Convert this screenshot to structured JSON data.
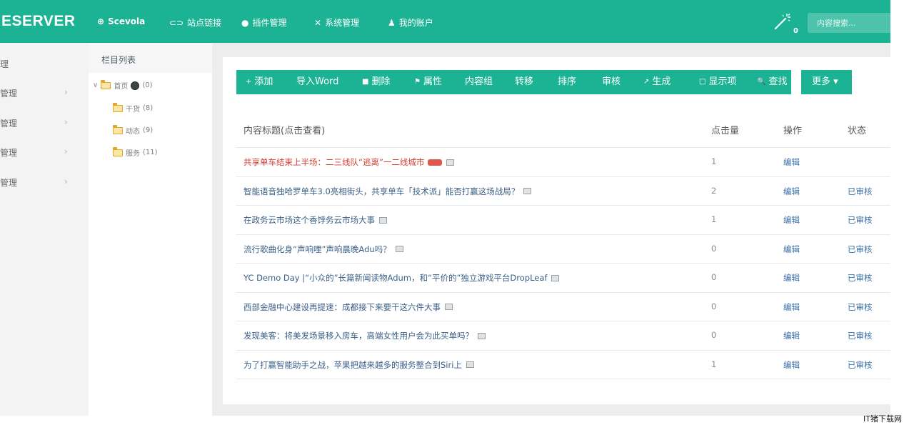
{
  "topbar": {
    "brand": "ESERVER",
    "nav": [
      {
        "label": "Scevola",
        "icon": "globe-icon",
        "glyph": "⊕"
      },
      {
        "label": "站点链接",
        "icon": "link-icon",
        "glyph": "⊂⊃"
      },
      {
        "label": "插件管理",
        "icon": "plugin-icon",
        "glyph": "●"
      },
      {
        "label": "系统管理",
        "icon": "tools-icon",
        "glyph": "✕"
      },
      {
        "label": "我的账户",
        "icon": "user-icon",
        "glyph": "♟"
      }
    ],
    "notification_count": "0",
    "search_placeholder": "内容搜索..."
  },
  "leftmenu": {
    "items": [
      {
        "label": "理",
        "chevron": ""
      },
      {
        "label": "管理",
        "chevron": "›"
      },
      {
        "label": "管理",
        "chevron": "›"
      },
      {
        "label": "管理",
        "chevron": "›"
      },
      {
        "label": "管理",
        "chevron": "›"
      }
    ]
  },
  "tree": {
    "title": "栏目列表",
    "root": {
      "toggle": "∨",
      "label": "首页",
      "count": "(0)"
    },
    "children": [
      {
        "label": "干货",
        "count": "(8)"
      },
      {
        "label": "动态",
        "count": "(9)"
      },
      {
        "label": "服务",
        "count": "(11)"
      }
    ]
  },
  "toolbar": {
    "buttons": [
      {
        "label": "添加",
        "glyph": "+"
      },
      {
        "label": "导入Word",
        "glyph": ""
      },
      {
        "label": "删除",
        "glyph": "■"
      },
      {
        "label": "属性",
        "glyph": "⚑"
      },
      {
        "label": "内容组",
        "glyph": ""
      },
      {
        "label": "转移",
        "glyph": ""
      },
      {
        "label": "排序",
        "glyph": ""
      },
      {
        "label": "审核",
        "glyph": ""
      },
      {
        "label": "生成",
        "glyph": "↗"
      },
      {
        "label": "显示项",
        "glyph": "□"
      },
      {
        "label": "查找",
        "glyph": "🔍"
      }
    ],
    "more_label": "更多 ▾"
  },
  "table": {
    "columns": [
      "内容标题(点击查看)",
      "点击量",
      "操作",
      "状态"
    ],
    "rows": [
      {
        "title": "共享单车结束上半场：二三线队“逃离”一二线城市",
        "hot": true,
        "clicks": "1",
        "op": "编辑",
        "status": ""
      },
      {
        "title": "智能语音独哈罗单车3.0亮相街头，共享单车「技术派」能否打赢这场战局？",
        "hot": false,
        "clicks": "2",
        "op": "编辑",
        "status": "已审核"
      },
      {
        "title": "在政务云市场这个香饽务云市场大事",
        "hot": false,
        "clicks": "1",
        "op": "编辑",
        "status": "已审核"
      },
      {
        "title": "流行歌曲化身“声响哩”声响晨晚Adu吗？",
        "hot": false,
        "clicks": "0",
        "op": "编辑",
        "status": "已审核"
      },
      {
        "title": "YC Demo Day |“小众的”长篇新闻读物Adum，和“平价的”独立游戏平台DropLeaf",
        "hot": false,
        "clicks": "0",
        "op": "编辑",
        "status": "已审核"
      },
      {
        "title": "西部金融中心建设再提速：成都接下来要干这六件大事",
        "hot": false,
        "clicks": "0",
        "op": "编辑",
        "status": "已审核"
      },
      {
        "title": "发现美客：将美发场景移入房车，高端女性用户会为此买单吗？",
        "hot": false,
        "clicks": "0",
        "op": "编辑",
        "status": "已审核"
      },
      {
        "title": "为了打赢智能助手之战，苹果把越来越多的服务整合到Siri上",
        "hot": false,
        "clicks": "1",
        "op": "编辑",
        "status": "已审核"
      }
    ]
  },
  "watermark": "IT猪下载网",
  "colors": {
    "accent": "#1cb394",
    "hot_title": "#d33f33",
    "link": "#3a6fa8"
  }
}
